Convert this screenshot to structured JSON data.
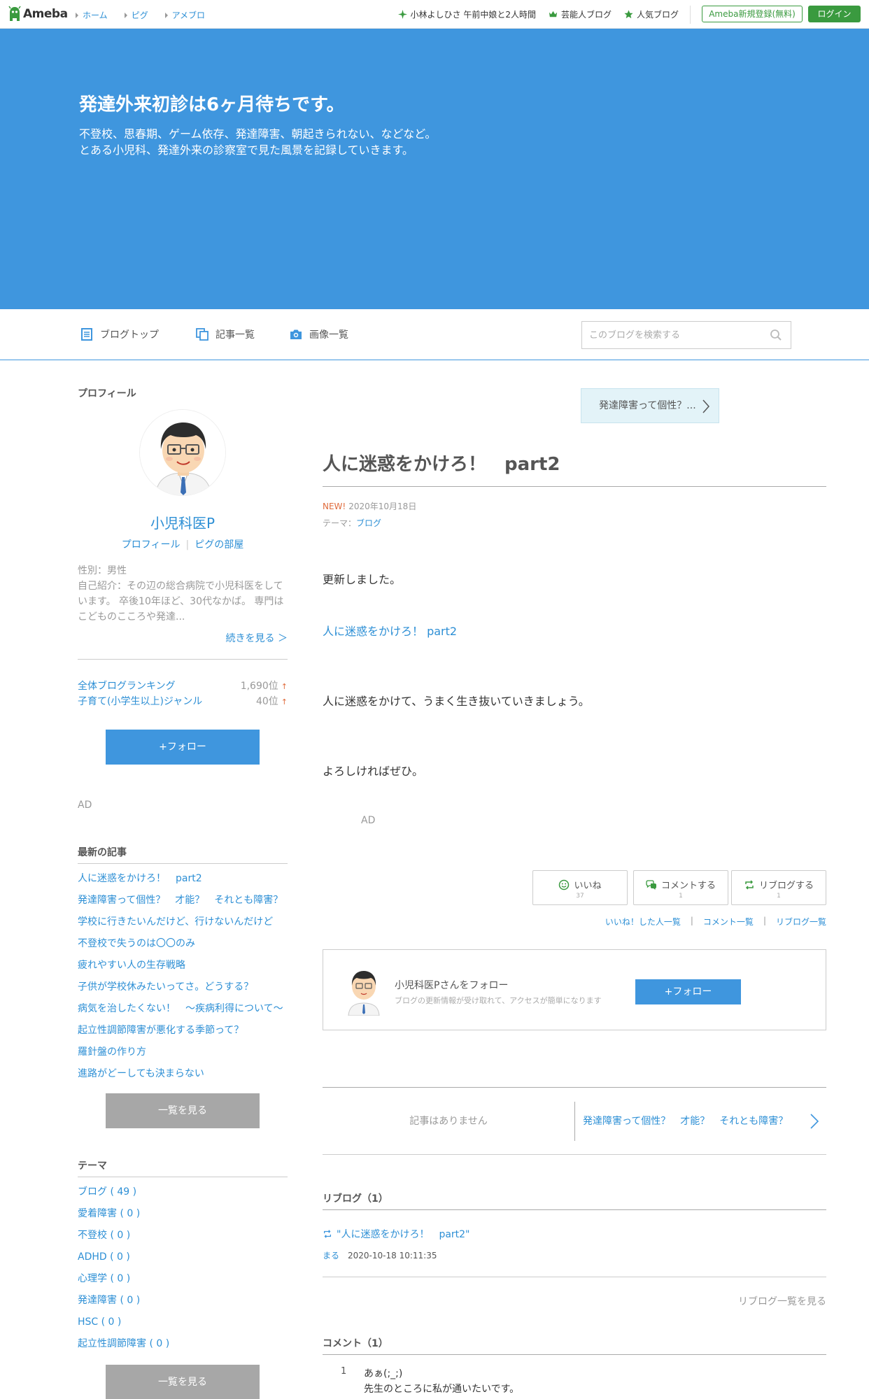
{
  "topbar": {
    "logo_text": "Ameba",
    "breadcrumbs": [
      "ホーム",
      "ピグ",
      "アメブロ"
    ],
    "links": [
      "小林よしひさ 午前中娘と2人時間",
      "芸能人ブログ",
      "人気ブログ"
    ],
    "register_label": "Ameba新規登録(無料)",
    "login_label": "ログイン"
  },
  "header": {
    "title": "発達外来初診は6ヶ月待ちです。",
    "description": "不登校、思春期、ゲーム依存、発達障害、朝起きられない、などなど。\nとある小児科、発達外来の診察室で見た風景を記録していきます。",
    "bg_color": "#3f96de"
  },
  "nav": {
    "items": [
      "ブログトップ",
      "記事一覧",
      "画像一覧"
    ],
    "search_placeholder": "このブログを検索する"
  },
  "sidebar": {
    "profile_heading": "プロフィール",
    "name": "小児科医P",
    "profile_link": "プロフィール",
    "pig_link": "ピグの部屋",
    "gender": "性別：男性",
    "intro": "自己紹介：その辺の総合病院で小児科医をしています。 卒後10年ほど、30代なかば。 専門はこどものこころや発達...",
    "more_label": "続きを見る ＞",
    "rankings": [
      {
        "label": "全体ブログランキング",
        "value": "1,690位",
        "trend": "↑"
      },
      {
        "label": "子育て(小学生以上)ジャンル",
        "value": "40位",
        "trend": "↑"
      }
    ],
    "follow_label": "+フォロー",
    "ad_label": "AD",
    "latest_heading": "最新の記事",
    "latest_posts": [
      "人に迷惑をかけろ！　part2",
      "発達障害って個性？　才能？　それとも障害？",
      "学校に行きたいんだけど、行けないんだけど",
      "不登校で失うのは〇〇のみ",
      "疲れやすい人の生存戦略",
      "子供が学校休みたいってさ。どうする？",
      "病気を治したくない！　〜疾病利得について〜",
      "起立性調節障害が悪化する季節って？",
      "羅針盤の作り方",
      "進路がどーしても決まらない"
    ],
    "list_more_label": "一覧を見る",
    "theme_heading": "テーマ",
    "themes": [
      "ブログ ( 49 )",
      "愛着障害 ( 0 )",
      "不登校 ( 0 )",
      "ADHD ( 0 )",
      "心理学 ( 0 )",
      "発達障害 ( 0 )",
      "HSC ( 0 )",
      "起立性調節障害 ( 0 )"
    ],
    "theme_more_label": "一覧を見る"
  },
  "article": {
    "prev_label": "発達障害って個性？...",
    "title": "人に迷惑をかけろ！　part2",
    "new_badge": "NEW!",
    "date": "2020年10月18日",
    "theme_prefix": "テーマ：",
    "theme": "ブログ",
    "p1": "更新しました。",
    "link": "人に迷惑をかけろ！ part2",
    "p2": "人に迷惑をかけて、うまく生き抜いていきましょう。",
    "p3": "よろしければぜひ。",
    "ad_label": "AD"
  },
  "reactions": {
    "like_label": "いいね",
    "like_count": "37",
    "comment_label": "コメントする",
    "comment_count": "1",
    "reblog_label": "リブログする",
    "reblog_count": "1",
    "like_list": "いいね！した人一覧",
    "comment_list": "コメント一覧",
    "reblog_list": "リブログ一覧"
  },
  "follow_card": {
    "title": "小児科医Pさんをフォロー",
    "subtitle": "ブログの更新情報が受け取れて、アクセスが簡単になります",
    "button": "+フォロー"
  },
  "pager": {
    "none_label": "記事はありません",
    "next_label": "発達障害って個性？　才能？　それとも障害？"
  },
  "reblogs": {
    "heading": "リブログ（1）",
    "item_title": "\"人に迷惑をかけろ！　part2\"",
    "item_author": "まる",
    "item_time": "2020-10-18 10:11:35",
    "more_label": "リブログ一覧を見る"
  },
  "comments": {
    "heading": "コメント（1）",
    "items": [
      {
        "num": "1",
        "text": "あぁ(;_;)\n先生のところに私が通いたいです。"
      }
    ]
  }
}
